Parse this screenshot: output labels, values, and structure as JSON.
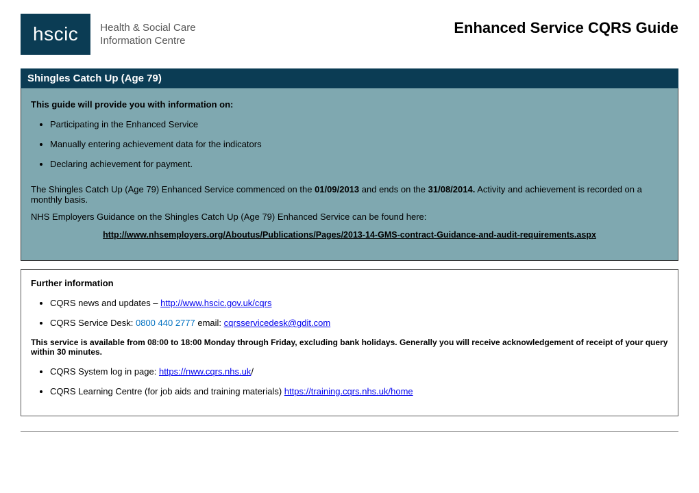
{
  "header": {
    "logo_abbrev": "hscic",
    "logo_line1": "Health & Social Care",
    "logo_line2": "Information Centre",
    "page_title": "Enhanced Service CQRS Guide"
  },
  "section": {
    "title": "Shingles Catch Up (Age 79)"
  },
  "intro": {
    "lead": "This guide will provide you with information on:",
    "bullets": [
      "Participating in the Enhanced  Service",
      "Manually entering achievement data for the indicators",
      "Declaring achievement for payment."
    ],
    "para1_pre": "The Shingles Catch Up (Age 79) Enhanced Service commenced on the ",
    "date1": "01/09/2013",
    "para1_mid": " and ends on the ",
    "date2": "31/08/2014.",
    "para1_post": " Activity and achievement is recorded on a monthly basis.",
    "para2": "NHS Employers Guidance on the Shingles Catch Up (Age 79) Enhanced Service can be found here:",
    "link": "http://www.nhsemployers.org/Aboutus/Publications/Pages/2013-14-GMS-contract-Guidance-and-audit-requirements.aspx"
  },
  "further": {
    "lead": "Further information",
    "item1_prefix": "CQRS news and updates – ",
    "item1_link": "http://www.hscic.gov.uk/cqrs",
    "item2_prefix": "CQRS Service Desk: ",
    "item2_phone": "0800 440 2777",
    "item2_email_label": " email: ",
    "item2_email": "cqrsservicedesk@gdit.com",
    "availability": "This service is available from 08:00 to 18:00 Monday through Friday, excluding bank holidays. Generally you will receive acknowledgement of receipt of your query within 30 minutes.",
    "item3_prefix": "CQRS System log in page: ",
    "item3_link": "https://nww.cqrs.nhs.uk",
    "item3_suffix": "/",
    "item4_prefix": "CQRS Learning Centre (for job aids and training materials) ",
    "item4_link": "https://training.cqrs.nhs.uk/home"
  }
}
